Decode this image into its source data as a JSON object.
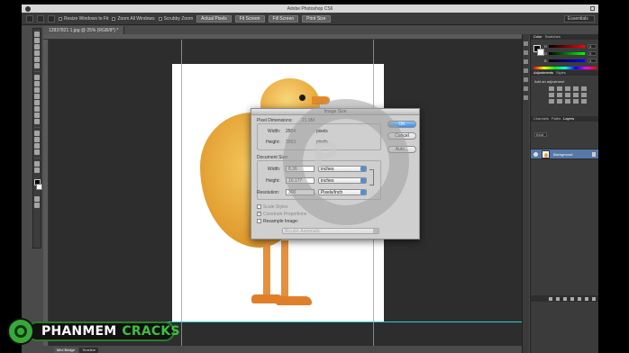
{
  "app": {
    "title": "Adobe Photoshop CS6"
  },
  "options_bar": {
    "resize_windows": "Resize Windows to Fit",
    "zoom_all": "Zoom All Windows",
    "scrubby_zoom": "Scrubby Zoom",
    "buttons": [
      "Actual Pixels",
      "Fit Screen",
      "Fill Screen",
      "Print Size"
    ],
    "workspace": "Essentials"
  },
  "document_tab": {
    "label": "12837821 1.jpg @ 25% (RGB/8*) *"
  },
  "dialog": {
    "title": "Image Size",
    "pixel_dimensions_label": "Pixel Dimensions:",
    "pixel_dimensions_value": "21.9M",
    "pixel_width_label": "Width:",
    "pixel_width_value": "2504",
    "pixel_width_unit": "pixels",
    "pixel_height_label": "Height:",
    "pixel_height_value": "3053",
    "pixel_height_unit": "pixels",
    "document_size_label": "Document Size:",
    "doc_width_label": "Width:",
    "doc_width_value": "8.36",
    "doc_width_unit": "inches",
    "doc_height_label": "Height:",
    "doc_height_value": "10.177",
    "doc_height_unit": "inches",
    "resolution_label": "Resolution:",
    "resolution_value": "300",
    "resolution_unit": "Pixels/Inch",
    "scale_styles": "Scale Styles",
    "constrain_proportions": "Constrain Proportions",
    "resample_image": "Resample Image:",
    "resample_method": "Bicubic Automatic",
    "ok": "OK",
    "cancel": "Cancel",
    "auto": "Auto..."
  },
  "panels": {
    "color_tabs": [
      "Color",
      "Swatches"
    ],
    "rgb": {
      "r_label": "R",
      "g_label": "G",
      "b_label": "B",
      "r_value": "0",
      "g_value": "0",
      "b_value": "0"
    },
    "adjust_tabs": [
      "Adjustments",
      "Styles"
    ],
    "adjust_title": "Add an adjustment",
    "layers_tabs": [
      "Channels",
      "Paths",
      "Layers"
    ],
    "layer_kind": "Kind",
    "layer_name": "Background"
  },
  "bottom_tabs": [
    "Mini Bridge",
    "Timeline"
  ],
  "logo": {
    "word1": "PHANMEM",
    "word2": "CRACKS"
  }
}
